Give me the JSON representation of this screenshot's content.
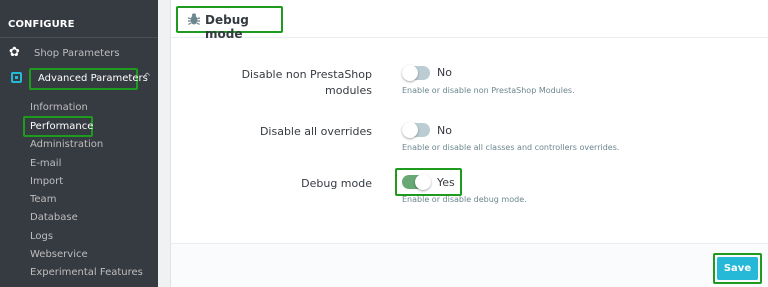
{
  "sidebar": {
    "section_title": "CONFIGURE",
    "shop_parameters": "Shop Parameters",
    "advanced_parameters": "Advanced Parameters",
    "submenu": [
      "Information",
      "Performance",
      "Administration",
      "E-mail",
      "Import",
      "Team",
      "Database",
      "Logs",
      "Webservice",
      "Experimental Features"
    ],
    "active_submenu": "Performance"
  },
  "panel": {
    "title": "Debug mode",
    "rows": [
      {
        "label_line1": "Disable non PrestaShop",
        "label_line2": "modules",
        "value": "No",
        "help": "Enable or disable non PrestaShop Modules."
      },
      {
        "label": "Disable all overrides",
        "value": "No",
        "help": "Enable or disable all classes and controllers overrides."
      },
      {
        "label": "Debug mode",
        "value": "Yes",
        "help": "Enable or disable debug mode."
      }
    ],
    "save_label": "Save"
  },
  "colors": {
    "sidebar_bg": "#363a41",
    "accent": "#25b9d7",
    "toggle_on": "#67a874",
    "toggle_off": "#bbcdd2",
    "highlight": "#1e9a1e"
  }
}
